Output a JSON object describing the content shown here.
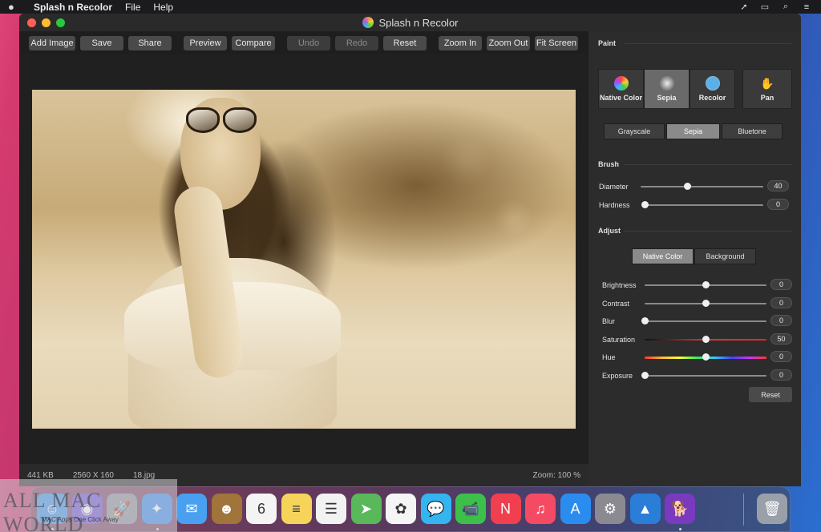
{
  "menubar": {
    "app_name": "Splash n Recolor",
    "menus": [
      "File",
      "Help"
    ]
  },
  "window": {
    "title": "Splash n Recolor"
  },
  "toolbar": {
    "buttons": [
      {
        "label": "Add Image",
        "enabled": true
      },
      {
        "label": "Save",
        "enabled": true
      },
      {
        "label": "Share",
        "enabled": true
      },
      {
        "label": "Preview",
        "enabled": true
      },
      {
        "label": "Compare",
        "enabled": true
      },
      {
        "label": "Undo",
        "enabled": false
      },
      {
        "label": "Redo",
        "enabled": false
      },
      {
        "label": "Reset",
        "enabled": true
      },
      {
        "label": "Zoom In",
        "enabled": true
      },
      {
        "label": "Zoom Out",
        "enabled": true
      },
      {
        "label": "Fit Screen",
        "enabled": true
      }
    ]
  },
  "statusbar": {
    "file_size": "441 KB",
    "dimensions": "2560 X 160",
    "file_name": "18.jpg",
    "zoom": "Zoom: 100 %"
  },
  "panel": {
    "paint": {
      "title": "Paint",
      "modes": [
        {
          "label": "Native Color",
          "icon": "color-wheel-icon",
          "active": false
        },
        {
          "label": "Sepia",
          "icon": "sepia-icon",
          "active": true
        },
        {
          "label": "Recolor",
          "icon": "recolor-icon",
          "active": false
        },
        {
          "label": "Pan",
          "icon": "hand-icon",
          "active": false
        }
      ],
      "filters": [
        {
          "label": "Grayscale",
          "active": false
        },
        {
          "label": "Sepia",
          "active": true
        },
        {
          "label": "Bluetone",
          "active": false
        }
      ]
    },
    "brush": {
      "title": "Brush",
      "diameter_label": "Diameter",
      "diameter_value": "40",
      "diameter_fraction": 0.38,
      "hardness_label": "Hardness",
      "hardness_value": "0",
      "hardness_fraction": 0
    },
    "adjust": {
      "title": "Adjust",
      "tabs": [
        {
          "label": "Native Color",
          "active": true
        },
        {
          "label": "Background",
          "active": false
        }
      ],
      "rows": [
        {
          "label": "Brightness",
          "value": "0",
          "fraction": 0.5,
          "kind": "plain"
        },
        {
          "label": "Contrast",
          "value": "0",
          "fraction": 0.5,
          "kind": "plain"
        },
        {
          "label": "Blur",
          "value": "0",
          "fraction": 0,
          "kind": "plain"
        },
        {
          "label": "Saturation",
          "value": "50",
          "fraction": 0.5,
          "kind": "sat"
        },
        {
          "label": "Hue",
          "value": "0",
          "fraction": 0.5,
          "kind": "hue"
        },
        {
          "label": "Exposure",
          "value": "0",
          "fraction": 0,
          "kind": "plain"
        }
      ],
      "reset_label": "Reset"
    }
  },
  "watermark": {
    "big": "ALL MAC WORLD",
    "small": "MAC Apps One Click Away"
  },
  "dock": {
    "items": [
      {
        "name": "finder-icon",
        "glyph": "☺",
        "color": "#3a8ee8"
      },
      {
        "name": "siri-icon",
        "glyph": "◉",
        "color": "#6a4ad0"
      },
      {
        "name": "launchpad-icon",
        "glyph": "🚀",
        "color": "#8c8c9a"
      },
      {
        "name": "safari-icon",
        "glyph": "✦",
        "color": "#2f86e8"
      },
      {
        "name": "mail-icon",
        "glyph": "✉",
        "color": "#4aa0f0"
      },
      {
        "name": "contacts-icon",
        "glyph": "☻",
        "color": "#a0743a"
      },
      {
        "name": "calendar-icon",
        "glyph": "6",
        "color": "#f4f4f4"
      },
      {
        "name": "notes-icon",
        "glyph": "≡",
        "color": "#f6d45a"
      },
      {
        "name": "reminders-icon",
        "glyph": "☰",
        "color": "#f2f2f2"
      },
      {
        "name": "maps-icon",
        "glyph": "➤",
        "color": "#58b85a"
      },
      {
        "name": "photos-icon",
        "glyph": "✿",
        "color": "#f5f5f5"
      },
      {
        "name": "messages-icon",
        "glyph": "💬",
        "color": "#34b5f0"
      },
      {
        "name": "facetime-icon",
        "glyph": "📹",
        "color": "#3cc04a"
      },
      {
        "name": "news-icon",
        "glyph": "N",
        "color": "#f04050"
      },
      {
        "name": "music-icon",
        "glyph": "♫",
        "color": "#f44a64"
      },
      {
        "name": "app-store-icon",
        "glyph": "A",
        "color": "#2b8cf0"
      },
      {
        "name": "system-preferences-icon",
        "glyph": "⚙",
        "color": "#8a8a90"
      },
      {
        "name": "altitude-icon",
        "glyph": "▲",
        "color": "#2a7ed8"
      },
      {
        "name": "splash-n-recolor-icon",
        "glyph": "🐕",
        "color": "#7a3ac0"
      },
      {
        "name": "trash-icon",
        "glyph": "🗑",
        "color": "#9aa0aa"
      }
    ]
  }
}
